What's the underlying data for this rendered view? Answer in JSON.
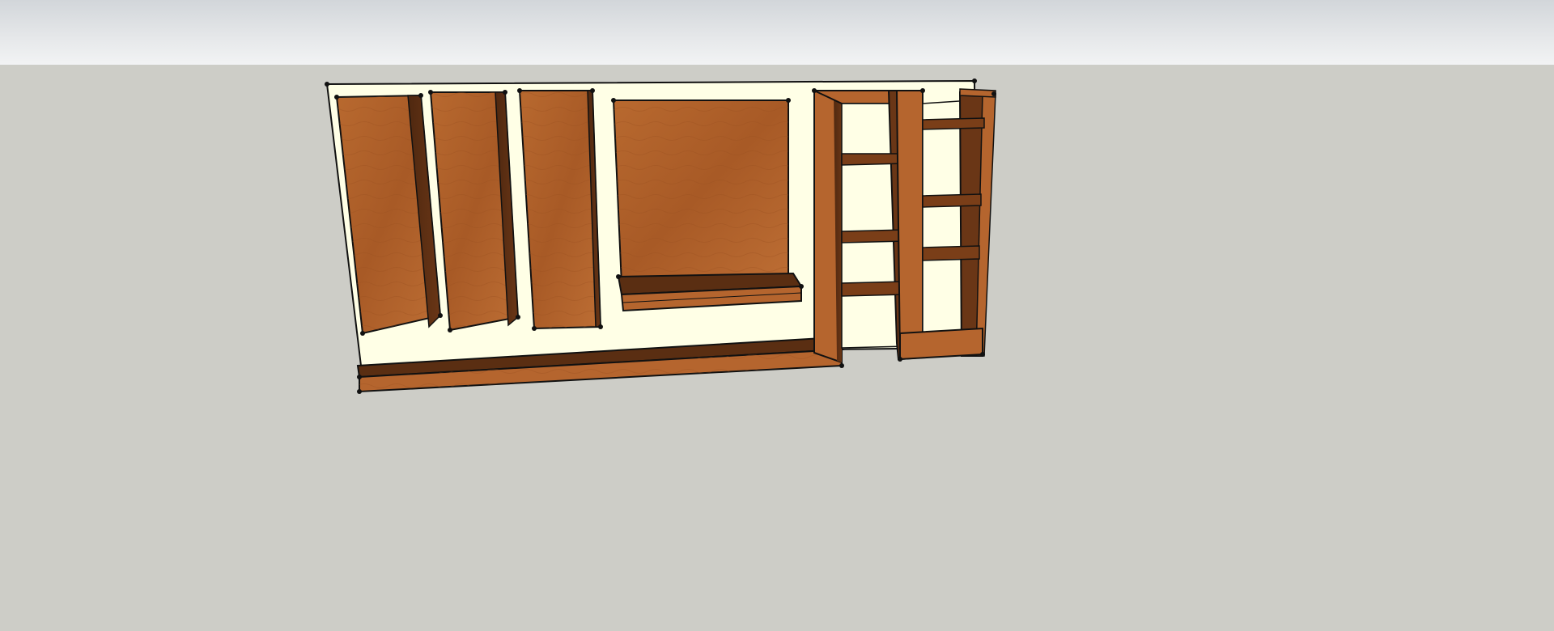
{
  "scene": {
    "type": "3d-model-viewport",
    "sky_color": "#e6e8ea",
    "ground_color": "#cdcdc7",
    "wall_color": "#ffffe6",
    "wood_light": "#b5652e",
    "wood_dark": "#5a2e12",
    "edge_color": "#111111"
  },
  "model": {
    "objects": [
      {
        "name": "wall-panel"
      },
      {
        "name": "tall-cabinet-1"
      },
      {
        "name": "tall-cabinet-2"
      },
      {
        "name": "tall-cabinet-3"
      },
      {
        "name": "center-panel"
      },
      {
        "name": "center-shelf"
      },
      {
        "name": "base-bench"
      },
      {
        "name": "bookcase-left",
        "shelf_count": 3
      },
      {
        "name": "bookcase-right",
        "shelf_count": 3
      }
    ]
  }
}
